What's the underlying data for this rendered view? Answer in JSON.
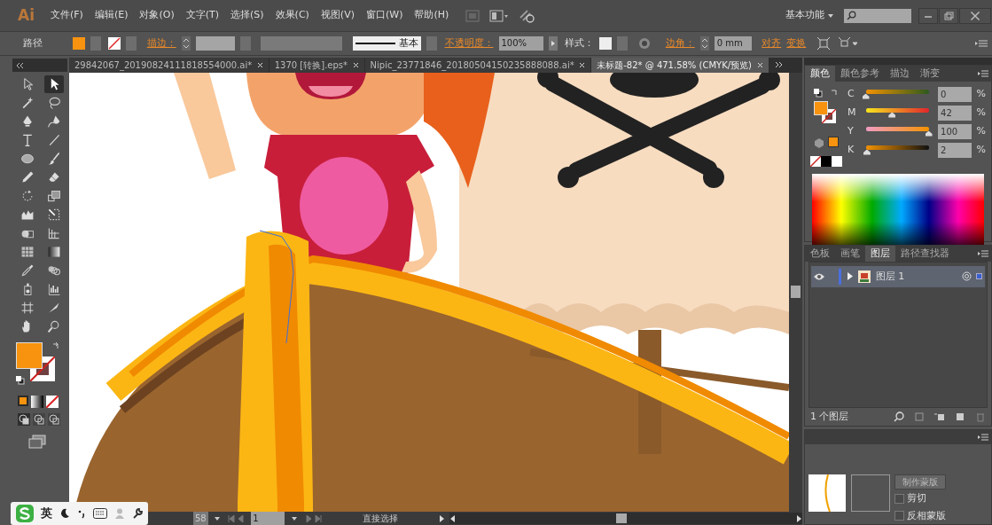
{
  "app": {
    "logo": "Ai",
    "workspace": "基本功能"
  },
  "menu": [
    "文件(F)",
    "编辑(E)",
    "对象(O)",
    "文字(T)",
    "选择(S)",
    "效果(C)",
    "视图(V)",
    "窗口(W)",
    "帮助(H)"
  ],
  "control_bar": {
    "selection": "路径",
    "stroke_label": "描边：",
    "stroke_profile": "基本",
    "opacity_label": "不透明度：",
    "opacity": "100%",
    "style_label": "样式：",
    "corner_label": "边角：",
    "corner": "0 mm",
    "align": "对齐",
    "transform": "变换"
  },
  "doc_tabs": [
    {
      "label": "29842067_20190824111818554000.ai*",
      "selected": false
    },
    {
      "label": "1370 [转换].eps*",
      "selected": false
    },
    {
      "label": "Nipic_23771846_20180504150235888088.ai*",
      "selected": false
    },
    {
      "label": "未标题-82* @ 471.58% (CMYK/预览)",
      "selected": true
    }
  ],
  "tools": [
    {
      "kind": "selection",
      "selected": false
    },
    {
      "kind": "direct",
      "selected": true
    },
    {
      "kind": "wand",
      "selected": false
    },
    {
      "kind": "lasso",
      "selected": false
    },
    {
      "kind": "pen",
      "selected": false
    },
    {
      "kind": "curvature",
      "selected": false
    },
    {
      "kind": "type",
      "selected": false
    },
    {
      "kind": "line",
      "selected": false
    },
    {
      "kind": "ellipse",
      "selected": false
    },
    {
      "kind": "brush",
      "selected": false
    },
    {
      "kind": "pencil",
      "selected": false
    },
    {
      "kind": "eraser",
      "selected": false
    },
    {
      "kind": "rotate",
      "selected": false
    },
    {
      "kind": "scale",
      "selected": false
    },
    {
      "kind": "width",
      "selected": false
    },
    {
      "kind": "transform",
      "selected": false
    },
    {
      "kind": "builder",
      "selected": false
    },
    {
      "kind": "perspective",
      "selected": false
    },
    {
      "kind": "mesh",
      "selected": false
    },
    {
      "kind": "gradient",
      "selected": false
    },
    {
      "kind": "eyedropper",
      "selected": false
    },
    {
      "kind": "blend",
      "selected": false
    },
    {
      "kind": "sprayer",
      "selected": false
    },
    {
      "kind": "graph",
      "selected": false
    },
    {
      "kind": "artboard",
      "selected": false
    },
    {
      "kind": "slice",
      "selected": false
    },
    {
      "kind": "hand",
      "selected": false
    },
    {
      "kind": "zoom",
      "selected": false
    }
  ],
  "fill": {
    "color": "#f7930f"
  },
  "color_panel": {
    "tabs": [
      {
        "label": "颜色",
        "selected": true
      },
      {
        "label": "颜色参考",
        "selected": false
      },
      {
        "label": "描边",
        "selected": false
      },
      {
        "label": "渐变",
        "selected": false
      }
    ],
    "channels": [
      {
        "name": "C",
        "level": 0,
        "value": "0",
        "unit": "%"
      },
      {
        "name": "M",
        "level": 0.42,
        "value": "42",
        "unit": "%"
      },
      {
        "name": "Y",
        "level": 1,
        "value": "100",
        "unit": "%"
      },
      {
        "name": "K",
        "level": 0.02,
        "value": "2",
        "unit": "%"
      }
    ]
  },
  "layers_panel": {
    "tabs": [
      {
        "label": "色板",
        "selected": false
      },
      {
        "label": "画笔",
        "selected": false
      },
      {
        "label": "图层",
        "selected": true
      },
      {
        "label": "路径查找器",
        "selected": false
      }
    ],
    "layers": [
      {
        "name": "图层 1",
        "visible": true,
        "expanded": false
      }
    ],
    "count": "1 个图层"
  },
  "transparency_panel": {
    "make_mask": "制作蒙版",
    "options": [
      {
        "label": "剪切",
        "checked": false
      },
      {
        "label": "反相蒙版",
        "checked": false
      }
    ]
  },
  "status_bar": {
    "zoom": "58",
    "page": "1",
    "tool": "直接选择"
  },
  "ime_toolbar": {
    "mode": "英"
  }
}
